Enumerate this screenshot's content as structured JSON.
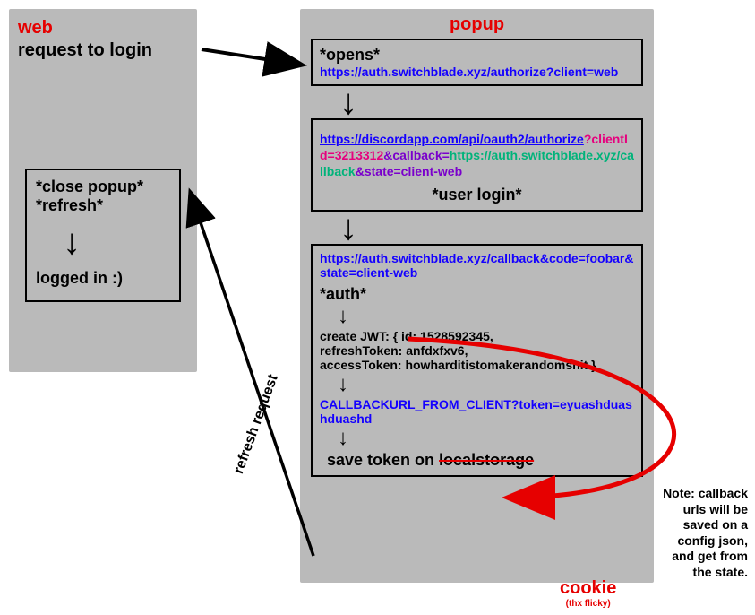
{
  "web": {
    "title": "web",
    "request_label": "request to login",
    "close_label": "*close popup*",
    "refresh_label": "*refresh*",
    "logged_in_label": "logged in :)"
  },
  "popup": {
    "title": "popup",
    "step1": {
      "action": "*opens*",
      "url": "https://auth.switchblade.xyz/authorize?client=web"
    },
    "step2": {
      "url_base": "https://discordapp.com/api/oauth2/authorize",
      "q_mark": "?",
      "clientId_key": "clientId=3213312",
      "amp1": "&",
      "callback_key": "callback=",
      "callback_val": "https://auth.switchblade.xyz/callback",
      "amp2": "&",
      "state": "state=client-web",
      "action": "*user login*"
    },
    "step3": {
      "url": "https://auth.switchblade.xyz/callback&code=foobar&state=client-web",
      "action": "*auth*",
      "jwt_line1": "create JWT: { id: 1528592345,",
      "jwt_line2": "refreshToken: anfdxfxv6,",
      "jwt_line3": "accessToken: howharditistomakerandomshit }",
      "callback_url": "CALLBACKURL_FROM_CLIENT?token=eyuashduashduashd",
      "save_prefix": "save token on ",
      "save_struck": "localstorage"
    }
  },
  "cookie_label": "cookie",
  "cookie_credit": "(thx flicky)",
  "refresh_request_label": "refresh request",
  "note_text": "Note: callback urls will be saved on a config json, and get from the state."
}
